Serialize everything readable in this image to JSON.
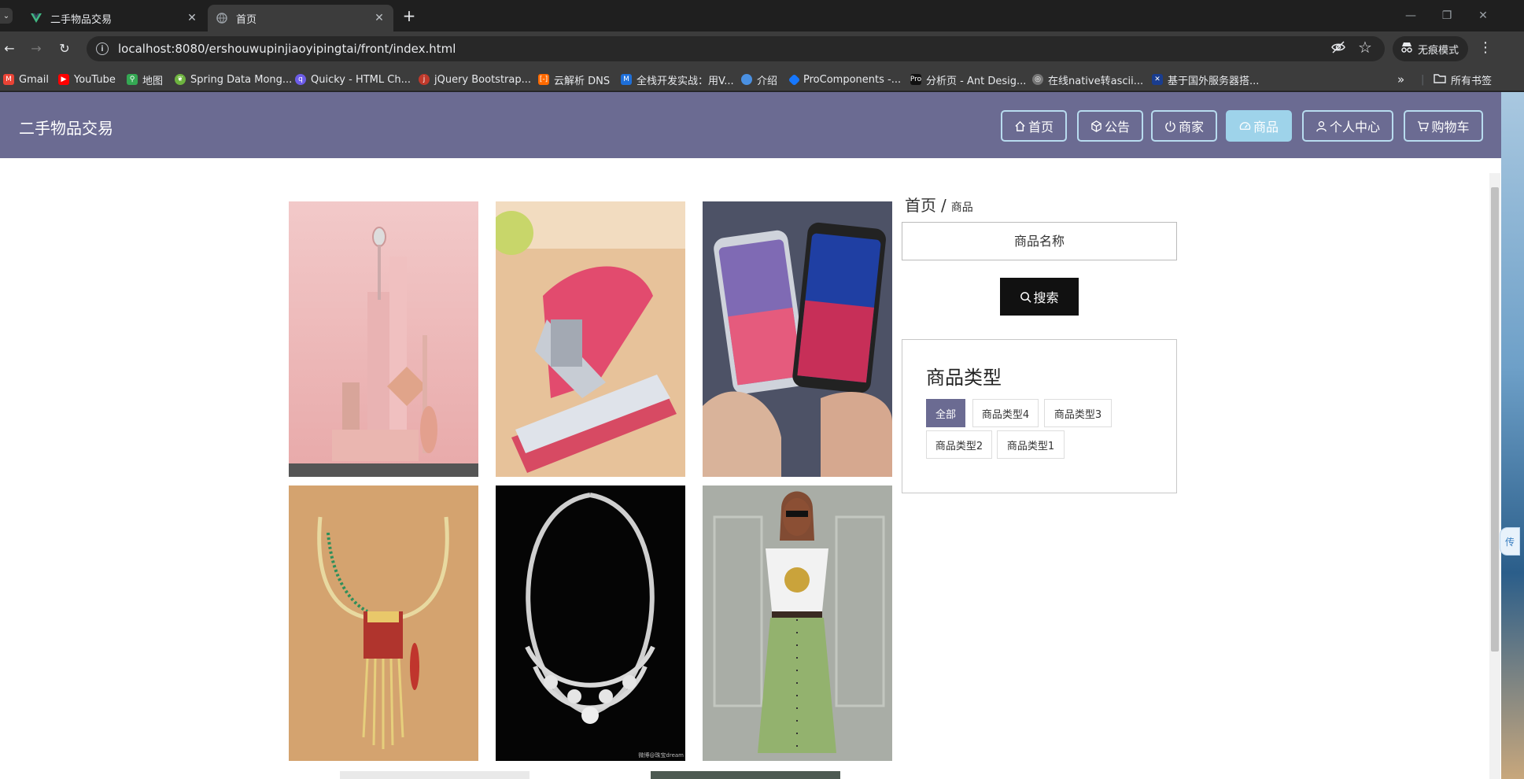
{
  "browser": {
    "tabs": [
      {
        "title": "二手物品交易",
        "active": false
      },
      {
        "title": "首页",
        "active": true
      }
    ],
    "url": "localhost:8080/ershouwupinjiaoyipingtai/front/index.html",
    "incognito_label": "无痕模式",
    "bookmarks": [
      {
        "label": "Gmail",
        "icon": "gmail-icon",
        "color": "#ea4335"
      },
      {
        "label": "YouTube",
        "icon": "youtube-icon",
        "color": "#ff0000"
      },
      {
        "label": "地图",
        "icon": "maps-icon",
        "color": "#34a853"
      },
      {
        "label": "Spring Data Mong...",
        "icon": "spring-icon",
        "color": "#6db33f"
      },
      {
        "label": "Quicky - HTML Ch...",
        "icon": "quicky-icon",
        "color": "#6c5ce7"
      },
      {
        "label": "jQuery Bootstrap...",
        "icon": "jquery-icon",
        "color": "#c0392b"
      },
      {
        "label": "云解析 DNS",
        "icon": "aliyun-icon",
        "color": "#ff6a00"
      },
      {
        "label": "全栈开发实战：用V...",
        "icon": "m-icon",
        "color": "#1e6fd9"
      },
      {
        "label": "介绍",
        "icon": "intro-icon",
        "color": "#4a90e2"
      },
      {
        "label": "ProComponents -...",
        "icon": "procomponents-icon",
        "color": "#1677ff"
      },
      {
        "label": "分析页 - Ant Desig...",
        "icon": "pro-icon",
        "color": "#111111"
      },
      {
        "label": "在线native转ascii...",
        "icon": "globe-icon",
        "color": "#888888"
      },
      {
        "label": "基于国外服务器搭...",
        "icon": "flag-icon",
        "color": "#1a3d8f"
      }
    ],
    "all_bookmarks_label": "所有书签"
  },
  "site": {
    "title": "二手物品交易",
    "nav": [
      {
        "label": "首页",
        "icon": "home-icon",
        "active": false
      },
      {
        "label": "公告",
        "icon": "cube-icon",
        "active": false
      },
      {
        "label": "商家",
        "icon": "power-icon",
        "active": false
      },
      {
        "label": "商品",
        "icon": "gauge-icon",
        "active": true
      },
      {
        "label": "个人中心",
        "icon": "user-icon",
        "active": false
      },
      {
        "label": "购物车",
        "icon": "cart-icon",
        "active": false
      }
    ],
    "colors": {
      "header": "#6b6b92",
      "active_nav": "#9ed3ea",
      "nav_border": "#b8dcef"
    }
  },
  "products": [
    {
      "image": "cosmetics-image"
    },
    {
      "image": "stapler-image"
    },
    {
      "image": "smartphones-image"
    },
    {
      "image": "gold-necklace-image"
    },
    {
      "image": "diamond-necklace-image",
      "watermark": "微博@珠宝dream"
    },
    {
      "image": "fashion-model-image"
    }
  ],
  "sidebar": {
    "breadcrumb_home": "首页",
    "breadcrumb_sep": "/",
    "breadcrumb_current": "商品",
    "search_placeholder": "商品名称",
    "search_button": "搜索",
    "category_title": "商品类型",
    "categories": [
      {
        "label": "全部",
        "active": true
      },
      {
        "label": "商品类型4",
        "active": false
      },
      {
        "label": "商品类型3",
        "active": false
      },
      {
        "label": "商品类型2",
        "active": false
      },
      {
        "label": "商品类型1",
        "active": false
      }
    ]
  },
  "side_widget": "传"
}
